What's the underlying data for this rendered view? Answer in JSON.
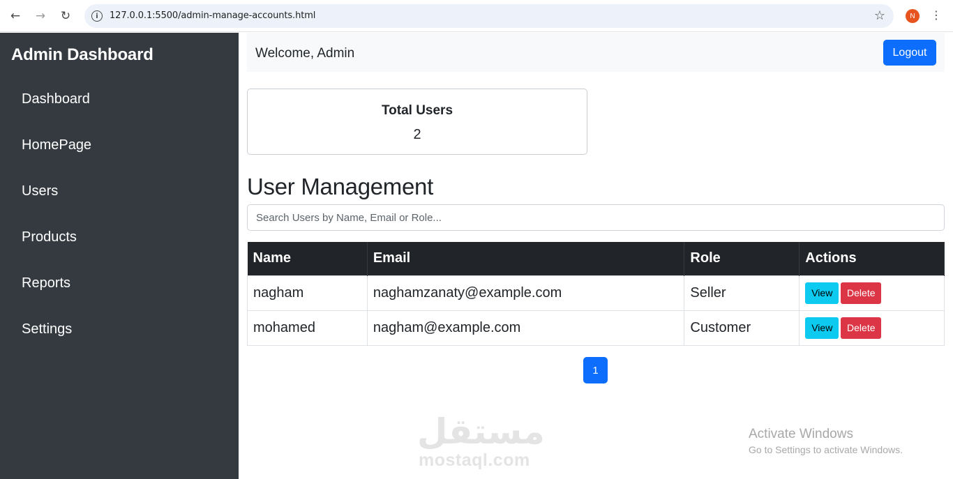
{
  "browser": {
    "url": "127.0.0.1:5500/admin-manage-accounts.html",
    "profile_initial": "N"
  },
  "sidebar": {
    "title": "Admin Dashboard",
    "items": [
      {
        "label": "Dashboard"
      },
      {
        "label": "HomePage"
      },
      {
        "label": "Users"
      },
      {
        "label": "Products"
      },
      {
        "label": "Reports"
      },
      {
        "label": "Settings"
      }
    ]
  },
  "topbar": {
    "welcome": "Welcome, Admin",
    "logout_label": "Logout"
  },
  "stats": {
    "total_users_label": "Total Users",
    "total_users_value": "2"
  },
  "main": {
    "section_title": "User Management",
    "search_placeholder": "Search Users by Name, Email or Role..."
  },
  "table": {
    "headers": {
      "name": "Name",
      "email": "Email",
      "role": "Role",
      "actions": "Actions"
    },
    "rows": [
      {
        "name": "nagham",
        "email": "naghamzanaty@example.com",
        "role": "Seller",
        "view": "View",
        "delete": "Delete"
      },
      {
        "name": "mohamed",
        "email": "nagham@example.com",
        "role": "Customer",
        "view": "View",
        "delete": "Delete"
      }
    ]
  },
  "pagination": {
    "current": "1"
  },
  "watermark": {
    "arabic": "مستقل",
    "latin": "mostaql.com"
  },
  "os_notice": {
    "title": "Activate Windows",
    "subtitle": "Go to Settings to activate Windows."
  },
  "colors": {
    "sidebar": "#343a40",
    "primary": "#0d6efd",
    "info": "#0dcaf0",
    "danger": "#dc3545",
    "table_header": "#212529"
  }
}
